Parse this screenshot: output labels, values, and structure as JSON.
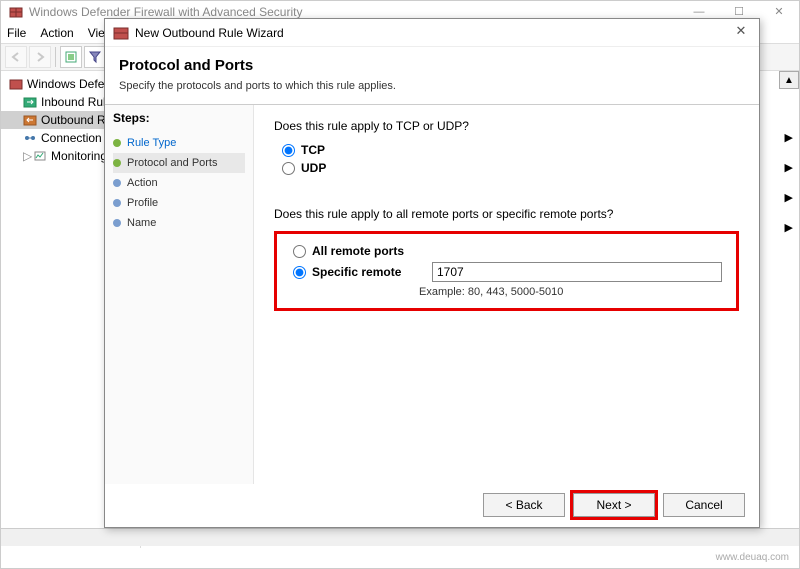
{
  "main_window": {
    "title": "Windows Defender Firewall with Advanced Security",
    "menu": {
      "file": "File",
      "action": "Action",
      "view": "View"
    }
  },
  "tree": {
    "root": "Windows Defender",
    "inbound": "Inbound Rule",
    "outbound": "Outbound Ru",
    "connection": "Connection S",
    "monitoring": "Monitoring"
  },
  "dialog": {
    "title": "New Outbound Rule Wizard",
    "heading": "Protocol and Ports",
    "subheading": "Specify the protocols and ports to which this rule applies.",
    "steps_title": "Steps:",
    "steps": {
      "rule_type": "Rule Type",
      "protocol_ports": "Protocol and Ports",
      "action": "Action",
      "profile": "Profile",
      "name": "Name"
    },
    "q_protocol": "Does this rule apply to TCP or UDP?",
    "tcp": "TCP",
    "udp": "UDP",
    "q_ports": "Does this rule apply to all remote ports or specific remote ports?",
    "all_remote": "All remote ports",
    "specific_remote": "Specific remote",
    "port_value": "1707",
    "example": "Example: 80, 443, 5000-5010",
    "back": "< Back",
    "next": "Next >",
    "cancel": "Cancel"
  },
  "footer": "www.deuaq.com"
}
